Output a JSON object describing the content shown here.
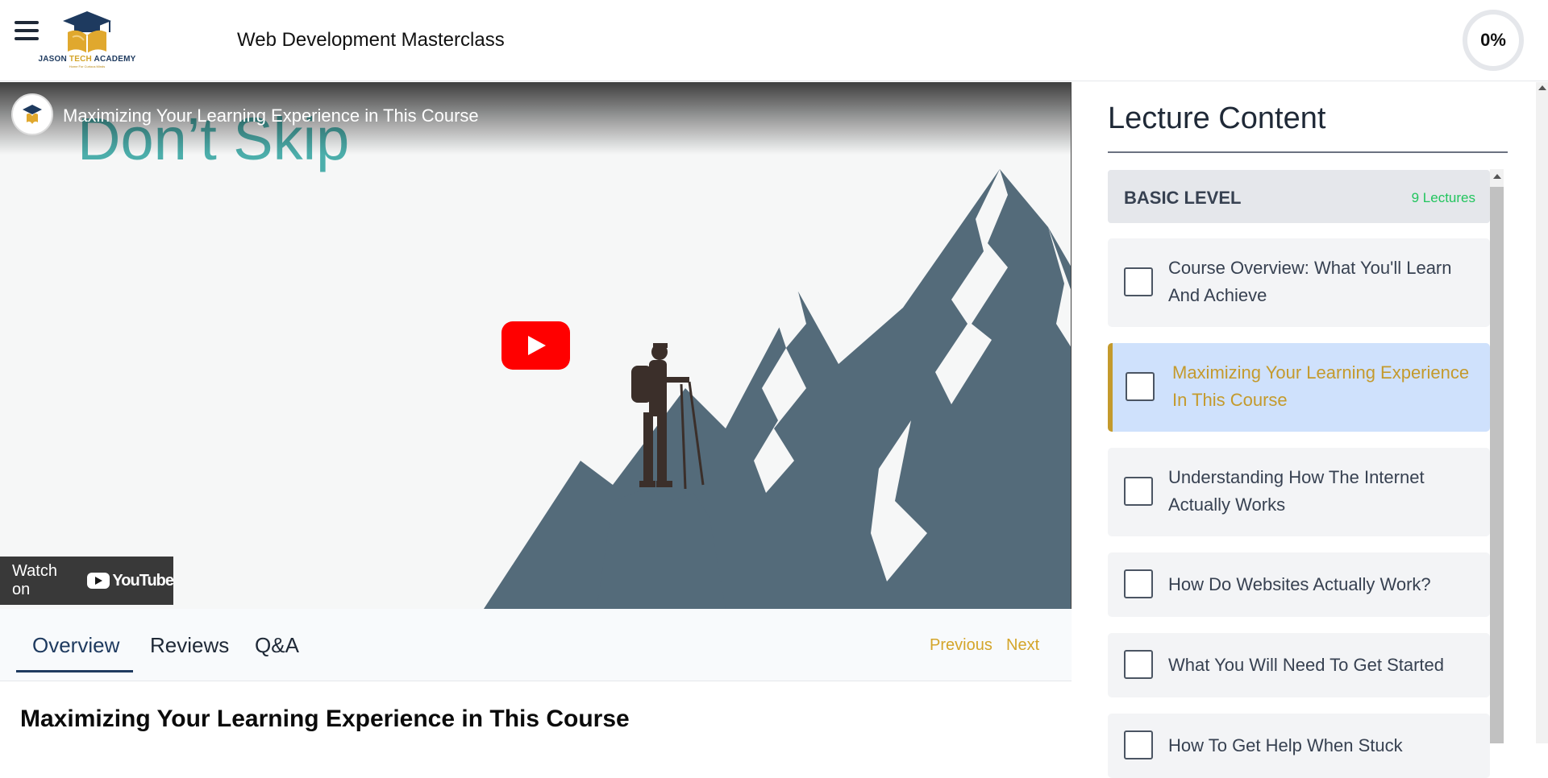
{
  "header": {
    "logo_text_part1": "JASON ",
    "logo_text_part2": "TECH",
    "logo_text_part3": " ACADEMY",
    "logo_tagline": "Home For Curious Minds",
    "course_title": "Web Development Masterclass",
    "progress": "0%"
  },
  "video": {
    "title": "Maximizing Your Learning Experience in This Course",
    "overlay_text": "Don’t Skip",
    "watch_on_label": "Watch on",
    "youtube_label": "YouTube"
  },
  "tabs": [
    {
      "label": "Overview",
      "active": true
    },
    {
      "label": "Reviews",
      "active": false
    },
    {
      "label": "Q&A",
      "active": false
    }
  ],
  "nav": {
    "previous": "Previous",
    "next": "Next"
  },
  "lecture_heading": "Maximizing Your Learning Experience in This Course",
  "sidebar": {
    "title": "Lecture Content",
    "section": {
      "name": "BASIC LEVEL",
      "count": "9 Lectures"
    },
    "lectures": [
      {
        "title": "Course Overview: What You'll Learn And Achieve",
        "active": false
      },
      {
        "title": "Maximizing Your Learning Experience In This Course",
        "active": true
      },
      {
        "title": "Understanding How The Internet Actually Works",
        "active": false
      },
      {
        "title": "How Do Websites Actually Work?",
        "active": false
      },
      {
        "title": "What You Will Need To Get Started",
        "active": false
      },
      {
        "title": "How To Get Help When Stuck",
        "active": false
      }
    ]
  },
  "colors": {
    "accent_gold": "#c49a2c",
    "navy": "#1e3a5f",
    "active_lecture_bg": "#cfe1fc",
    "lecture_count_green": "#22c55e",
    "youtube_red": "#ff0000"
  }
}
